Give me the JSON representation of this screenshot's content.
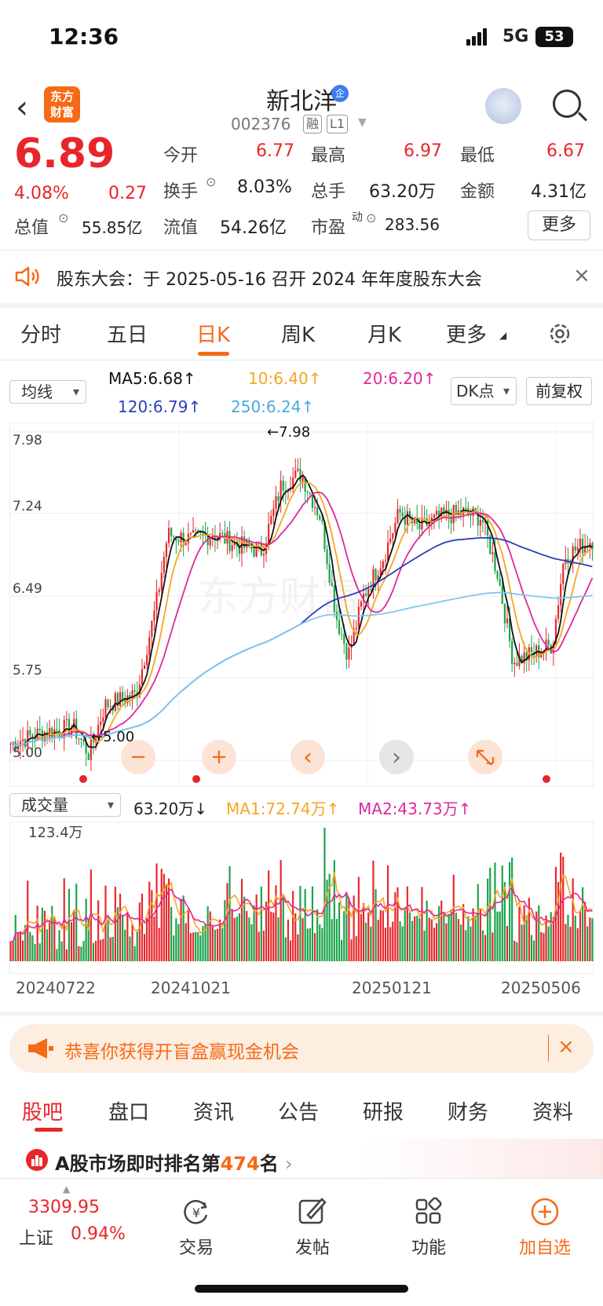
{
  "status_bar": {
    "time": "12:36",
    "network": "5G",
    "battery": "53"
  },
  "header": {
    "logo_line1": "东方",
    "logo_line2": "财富",
    "stock_name": "新北洋",
    "badge": "企",
    "stock_code": "002376",
    "tag1": "融",
    "tag2": "L1"
  },
  "quote": {
    "price": "6.89",
    "change_pct": "4.08%",
    "change": "0.27",
    "open_label": "今开",
    "open": "6.77",
    "high_label": "最高",
    "high": "6.97",
    "low_label": "最低",
    "low": "6.67",
    "turnover_label": "换手",
    "turnover": "8.03%",
    "volume_label": "总手",
    "volume": "63.20万",
    "amount_label": "金额",
    "amount": "4.31亿",
    "mcap_label": "总值",
    "mcap": "55.85亿",
    "float_label": "流值",
    "float": "54.26亿",
    "pe_label": "市盈",
    "pe_sup": "动",
    "pe": "283.56",
    "more_label": "更多"
  },
  "notice": {
    "text": "股东大会：于 2025-05-16 召开 2024 年年度股东大会",
    "close": "×"
  },
  "tabs": [
    {
      "label": "分时"
    },
    {
      "label": "五日"
    },
    {
      "label": "日K",
      "active": true
    },
    {
      "label": "周K"
    },
    {
      "label": "月K"
    },
    {
      "label": "更多"
    }
  ],
  "indicators": {
    "ma_selector": "均线",
    "ma5": "MA5:6.68↑",
    "ma10": "10:6.40↑",
    "ma20": "20:6.20↑",
    "ma120": "120:6.79↑",
    "ma250": "250:6.24↑",
    "dk_button": "DK点",
    "fq_button": "前复权",
    "colors": {
      "ma5": "#111111",
      "ma10": "#f5a623",
      "ma20": "#e0289a",
      "ma120": "#2b3fb8",
      "ma250": "#7fc8f0"
    }
  },
  "kline": {
    "y_labels": [
      "7.98",
      "7.24",
      "6.49",
      "5.75",
      "5.00"
    ],
    "max_label": "←7.98",
    "min_label": "←5.00",
    "zoom_out": "−",
    "zoom_in": "+",
    "prev": "‹",
    "next": "›"
  },
  "volume": {
    "selector": "成交量",
    "value": "63.20万↓",
    "ma1": "MA1:72.74万↑",
    "ma2": "MA2:43.73万↑",
    "axis_max": "123.4万"
  },
  "dates": [
    "20240722",
    "20241021",
    "20250121",
    "20250506"
  ],
  "promo": {
    "text": "恭喜你获得开盲盒赢现金机会",
    "close": "×"
  },
  "sub_tabs": [
    {
      "label": "股吧",
      "active": true
    },
    {
      "label": "盘口"
    },
    {
      "label": "资讯"
    },
    {
      "label": "公告"
    },
    {
      "label": "研报"
    },
    {
      "label": "财务"
    },
    {
      "label": "资料"
    }
  ],
  "rank": {
    "prefix": "A股市场即时排名第",
    "num": "474",
    "suffix": "名",
    "chevron": "›"
  },
  "bottom_bar": {
    "index_value": "3309.95",
    "index_name": "上证",
    "index_change": "0.94%",
    "items": [
      {
        "label": "交易"
      },
      {
        "label": "发帖"
      },
      {
        "label": "功能"
      },
      {
        "label": "加自选"
      }
    ]
  }
}
